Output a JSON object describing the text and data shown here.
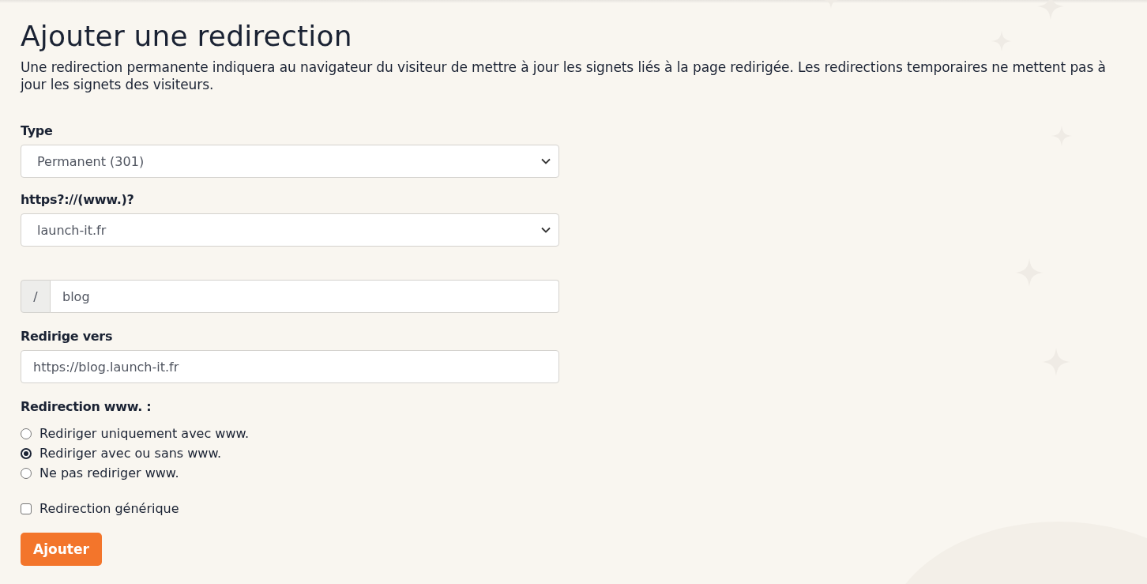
{
  "title": "Ajouter une redirection",
  "description": "Une redirection permanente indiquera au navigateur du visiteur de mettre à jour les signets liés à la page redirigée. Les redirections temporaires ne mettent pas à jour les signets des visiteurs.",
  "type_field": {
    "label": "Type",
    "value": "Permanent (301)"
  },
  "domain_field": {
    "label": "https?://(www.)?",
    "value": "launch-it.fr"
  },
  "path_field": {
    "prefix": "/",
    "value": "blog"
  },
  "target_field": {
    "label": "Redirige vers",
    "value": "https://blog.launch-it.fr"
  },
  "www_redirection": {
    "label": "Redirection www. :",
    "options": [
      {
        "label": "Rediriger uniquement avec www.",
        "selected": false
      },
      {
        "label": "Rediriger avec ou sans www.",
        "selected": true
      },
      {
        "label": "Ne pas rediriger www.",
        "selected": false
      }
    ]
  },
  "wildcard": {
    "label": "Redirection générique",
    "checked": false
  },
  "submit_button": "Ajouter"
}
